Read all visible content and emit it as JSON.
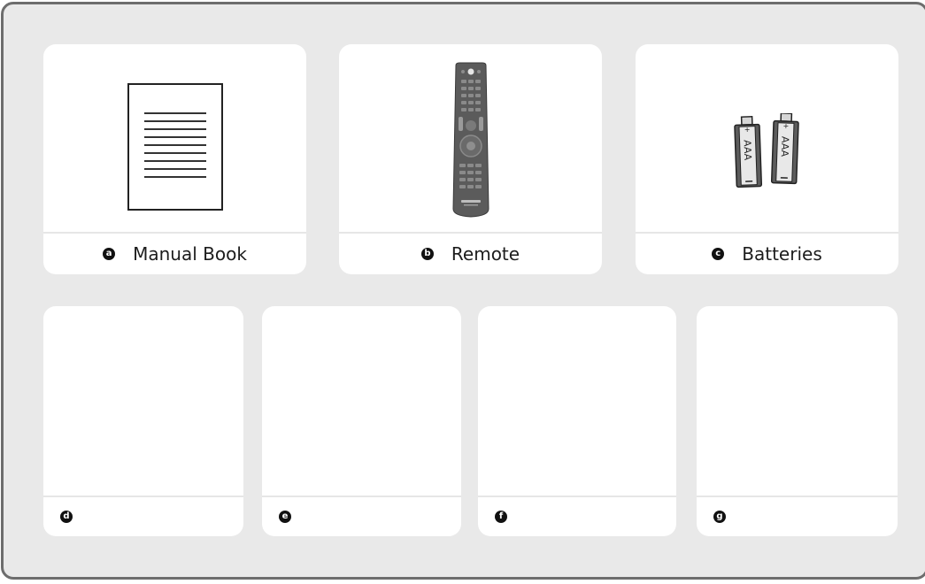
{
  "items": [
    {
      "letter": "a",
      "label": "Manual Book",
      "icon": "manual-book-icon"
    },
    {
      "letter": "b",
      "label": "Remote",
      "icon": "remote-control-icon"
    },
    {
      "letter": "c",
      "label": "Batteries",
      "icon": "batteries-icon"
    }
  ],
  "batteries": {
    "type_label": "AAA"
  },
  "empty_slots": [
    {
      "letter": "d"
    },
    {
      "letter": "e"
    },
    {
      "letter": "f"
    },
    {
      "letter": "g"
    }
  ],
  "colors": {
    "panel_bg": "#e9e9e9",
    "panel_border": "#6d6d6d",
    "card_bg": "#ffffff",
    "badge": "#111111"
  }
}
